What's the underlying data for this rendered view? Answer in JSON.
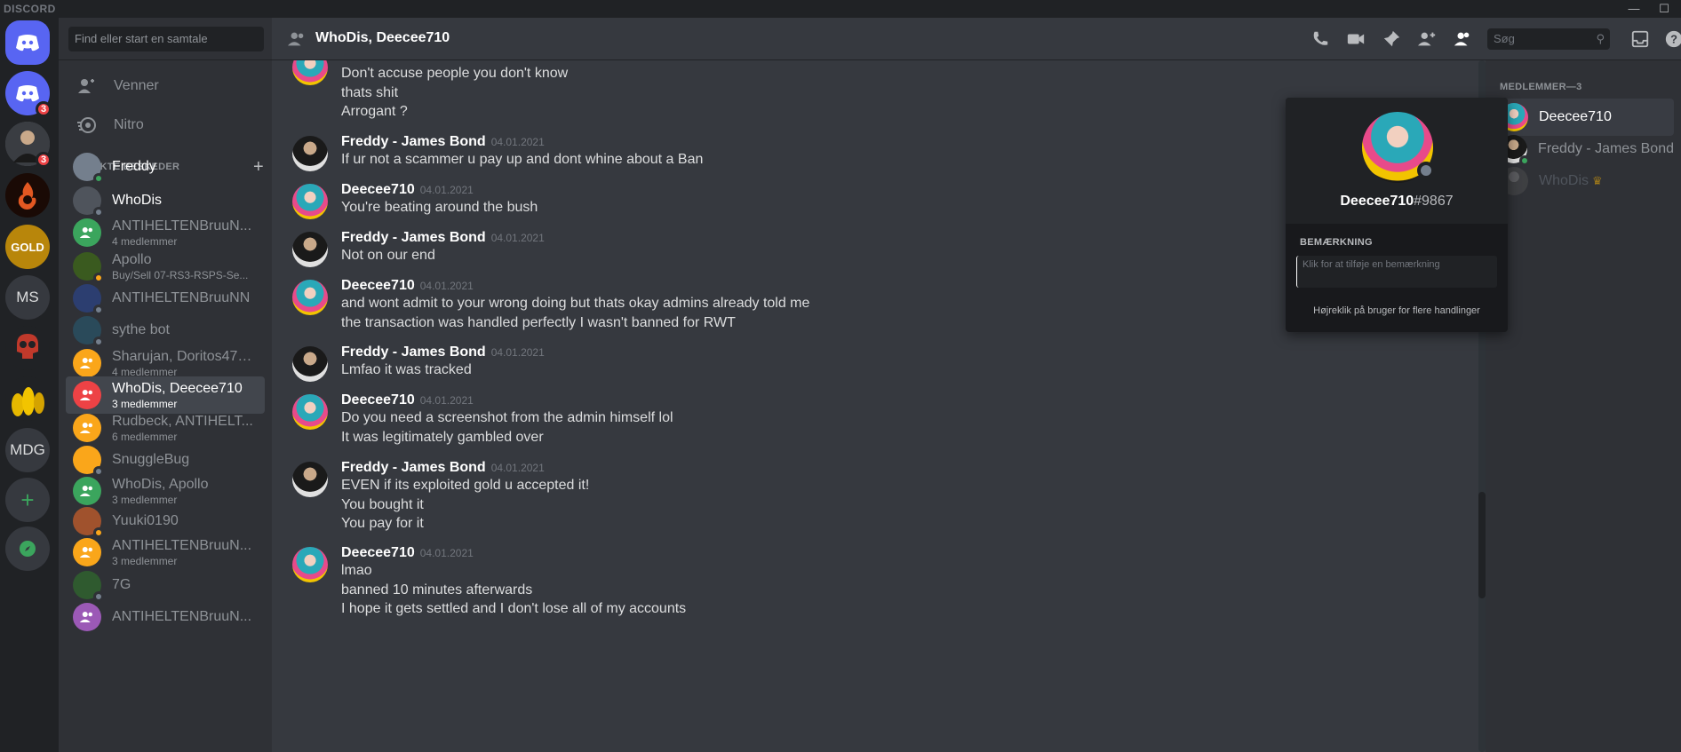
{
  "titlebar": {
    "brand": "DISCORD",
    "minimize": "—",
    "maximize": "☐"
  },
  "guilds": [
    {
      "name": "home",
      "label": "",
      "color": "#5865f2",
      "badge": ""
    },
    {
      "name": "guild-discord",
      "label": "",
      "color": "#5865f2",
      "badge": "3"
    },
    {
      "name": "guild-user",
      "label": "",
      "color": "#4f545c",
      "badge": "3"
    },
    {
      "name": "guild-ace",
      "label": "",
      "color": "#8b1a10",
      "badge": ""
    },
    {
      "name": "guild-gold",
      "label": "GOLD",
      "color": "#b8860b",
      "badge": ""
    },
    {
      "name": "guild-ms",
      "label": "MS",
      "color": "#36393f",
      "badge": ""
    },
    {
      "name": "guild-red-skull",
      "label": "",
      "color": "#7a1818",
      "badge": ""
    },
    {
      "name": "guild-gold-coins",
      "label": "",
      "color": "#202225",
      "badge": ""
    },
    {
      "name": "guild-mdg",
      "label": "MDG",
      "color": "#36393f",
      "badge": ""
    }
  ],
  "dm_search": {
    "placeholder": "Find eller start en samtale"
  },
  "nav": {
    "friends": "Venner",
    "nitro": "Nitro"
  },
  "dm_header": {
    "label": "DIREKTE BESKEDER",
    "add": "+"
  },
  "dms": [
    {
      "name": "Freddy",
      "sub": "",
      "color": "#747f8d",
      "status": "#3ba55d",
      "group": false
    },
    {
      "name": "WhoDis",
      "sub": "",
      "color": "#4f545c",
      "status": "#747f8d",
      "group": false
    },
    {
      "name": "ANTIHELTENBruuN...",
      "sub": "4 medlemmer",
      "color": "#3ba55d",
      "status": "",
      "group": true
    },
    {
      "name": "Apollo",
      "sub": "Buy/Sell 07-RS3-RSPS-Se...",
      "color": "#3a5a1f",
      "status": "#faa61a",
      "group": false
    },
    {
      "name": "ANTIHELTENBruuNN",
      "sub": "",
      "color": "#2c3e70",
      "status": "#747f8d",
      "group": false
    },
    {
      "name": "sythe bot",
      "sub": "",
      "color": "#2a4a5a",
      "status": "#747f8d",
      "group": false
    },
    {
      "name": "Sharujan, Doritos477...",
      "sub": "4 medlemmer",
      "color": "#faa61a",
      "status": "",
      "group": true
    },
    {
      "name": "WhoDis, Deecee710",
      "sub": "3 medlemmer",
      "color": "#ed4245",
      "status": "",
      "group": true
    },
    {
      "name": "Rudbeck, ANTIHELT...",
      "sub": "6 medlemmer",
      "color": "#faa61a",
      "status": "",
      "group": true
    },
    {
      "name": "SnuggleBug",
      "sub": "",
      "color": "#faa61a",
      "status": "#747f8d",
      "group": false
    },
    {
      "name": "WhoDis, Apollo",
      "sub": "3 medlemmer",
      "color": "#3ba55d",
      "status": "",
      "group": true
    },
    {
      "name": "Yuuki0190",
      "sub": "",
      "color": "#a0522d",
      "status": "#faa61a",
      "group": false
    },
    {
      "name": "ANTIHELTENBruuN...",
      "sub": "3 medlemmer",
      "color": "#faa61a",
      "status": "",
      "group": true
    },
    {
      "name": "7G",
      "sub": "",
      "color": "#2f5a2f",
      "status": "#747f8d",
      "group": false
    },
    {
      "name": "ANTIHELTENBruuN...",
      "sub": "",
      "color": "#9b59b6",
      "status": "",
      "group": true
    }
  ],
  "channel": {
    "title": "WhoDis, Deecee710",
    "search_placeholder": "Søg"
  },
  "messages": [
    {
      "author": "Deecee710",
      "time": "04.01.2021",
      "lines": [
        "Don't accuse people you don't know",
        "thats shit",
        "Arrogant ?"
      ]
    },
    {
      "author": "Freddy - James Bond",
      "time": "04.01.2021",
      "lines": [
        "If ur not a scammer u pay up and dont whine about a Ban"
      ]
    },
    {
      "author": "Deecee710",
      "time": "04.01.2021",
      "lines": [
        "You're beating around the bush"
      ]
    },
    {
      "author": "Freddy - James Bond",
      "time": "04.01.2021",
      "lines": [
        "Not on our end"
      ]
    },
    {
      "author": "Deecee710",
      "time": "04.01.2021",
      "lines": [
        "and wont admit to your wrong doing but thats okay admins already told me",
        "the transaction was handled perfectly I wasn't banned for RWT"
      ]
    },
    {
      "author": "Freddy - James Bond",
      "time": "04.01.2021",
      "lines": [
        "Lmfao it was tracked"
      ]
    },
    {
      "author": "Deecee710",
      "time": "04.01.2021",
      "lines": [
        "Do you need a screenshot from the admin himself lol",
        "It was legitimately gambled over"
      ]
    },
    {
      "author": "Freddy - James Bond",
      "time": "04.01.2021",
      "lines": [
        "EVEN if its exploited gold u accepted it!",
        "You bought it",
        "You pay for it"
      ]
    },
    {
      "author": "Deecee710",
      "time": "04.01.2021",
      "lines": [
        "lmao",
        "banned 10 minutes afterwards",
        "I hope it gets settled and I don't lose all of my accounts"
      ]
    }
  ],
  "members": {
    "header": "MEDLEMMER—3",
    "list": [
      {
        "name": "Deecee710",
        "status": ""
      },
      {
        "name": "Freddy - James Bond",
        "status": "#3ba55d"
      },
      {
        "name": "WhoDis",
        "status": "",
        "crown": "♛"
      }
    ]
  },
  "popout": {
    "username": "Deecee710",
    "discriminator": "#9867",
    "note_label": "BEMÆRKNING",
    "note_placeholder": "Klik for at tilføje en bemærkning",
    "hint": "Højreklik på bruger for flere handlinger"
  }
}
